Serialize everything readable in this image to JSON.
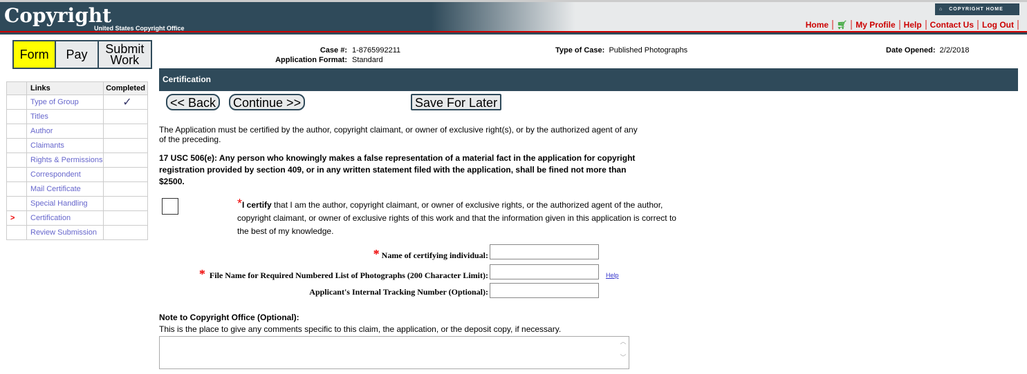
{
  "header": {
    "logo": "Copyright",
    "logo_sub": "United States Copyright Office",
    "copyright_home": "COPYRIGHT HOME",
    "links": [
      "Home",
      "My Profile",
      "Help",
      "Contact Us",
      "Log Out"
    ]
  },
  "tabs": [
    "Form",
    "Pay",
    "Submit Work"
  ],
  "nav": {
    "col_links": "Links",
    "col_completed": "Completed",
    "check": "✓",
    "items": [
      "Type of Group",
      "Titles",
      "Author",
      "Claimants",
      "Rights & Permissions",
      "Correspondent",
      "Mail Certificate",
      "Special Handling",
      "Certification",
      "Review Submission"
    ]
  },
  "meta": {
    "case_label": "Case #:",
    "case_value": "1-8765992211",
    "format_label": "Application Format:",
    "format_value": "Standard",
    "type_label": "Type of Case:",
    "type_value": "Published Photographs",
    "date_label": "Date Opened:",
    "date_value": "2/2/2018"
  },
  "section_title": "Certification",
  "buttons": {
    "back": "<< Back",
    "continue": "Continue >>",
    "save": "Save For Later"
  },
  "intro": "The Application must be certified by the author, copyright claimant, or owner of exclusive right(s), or by the authorized agent of any of the preceding.",
  "warning": "17 USC 506(e): Any person who knowingly makes a false representation of a material fact in the application for copyright registration provided by section 409, or in any written statement filed with the application, shall be fined not more than $2500.",
  "certify_bold": "I certify",
  "certify_text": " that I am the author, copyright claimant, or owner of exclusive rights, or the authorized agent of the author, copyright claimant, or owner of exclusive rights of this work and that the information given in this application is correct to the best of my knowledge.",
  "fields": {
    "name": "Name of certifying individual:",
    "file": "File Name for Required Numbered List of Photographs (200 Character Limit):",
    "tracking": "Applicant's Internal Tracking Number (Optional):",
    "help": "Help"
  },
  "note_title": "Note to Copyright Office (Optional):",
  "note_desc": "This is the place to give any comments specific to this claim, the application, or the deposit copy, if necessary."
}
